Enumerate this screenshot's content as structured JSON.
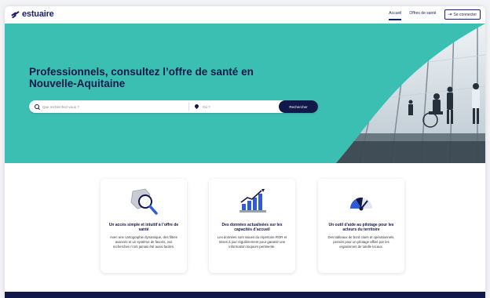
{
  "header": {
    "logo": "estuaire",
    "logo_sub": "",
    "nav": [
      {
        "label": "Accueil",
        "active": true
      },
      {
        "label": "Offres de santé",
        "active": false
      }
    ],
    "login_label": "Se connecter"
  },
  "hero": {
    "title": "Professionnels, consultez l’offre de santé en Nouvelle-Aquitaine",
    "search": {
      "what_placeholder": "Que recherchez-vous ?",
      "where_placeholder": "Où ?",
      "button_label": "Rechercher"
    }
  },
  "features": [
    {
      "icon": "magnifier-map-icon",
      "title": "Un accès simple et intuitif à l’offre de santé",
      "text": "Avec une cartographie dynamique, des filtres avancés et un système de favoris, vos recherches n’ont jamais été aussi faciles."
    },
    {
      "icon": "chart-growth-icon",
      "title": "Des données actualisées sur les capacités d’accueil",
      "text": "Les données sont issues du répertoire ROR et mises à jour régulièrement pour garantir une information toujours pertinente."
    },
    {
      "icon": "gauge-icon",
      "title": "Un outil d’aide au pilotage pour les acteurs du territoire",
      "text": "Des tableaux de bord clairs et opérationnels, pensés pour un pilotage affiné par les organismes de tutelle locaux."
    }
  ],
  "colors": {
    "primary": "#12184a",
    "hero_bg": "#3bbfb3",
    "accent_blue": "#2f5bd8"
  }
}
